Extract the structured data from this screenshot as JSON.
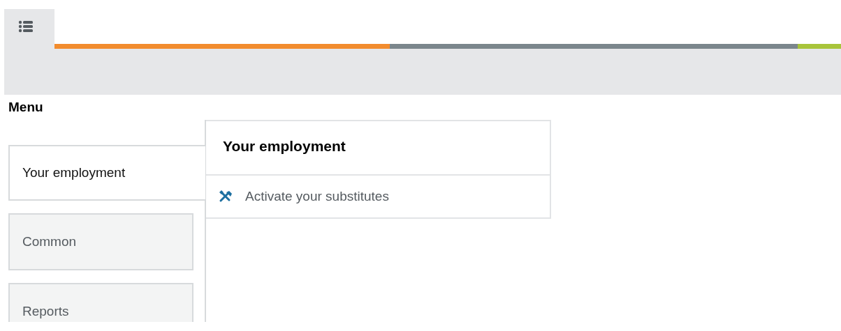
{
  "menu_title": "Menu",
  "tabs": [
    {
      "label": "Your employment",
      "selected": true
    },
    {
      "label": "Common",
      "selected": false
    },
    {
      "label": "Reports",
      "selected": false
    }
  ],
  "panel": {
    "title": "Your employment",
    "items": [
      {
        "label": "Activate your substitutes"
      }
    ]
  }
}
